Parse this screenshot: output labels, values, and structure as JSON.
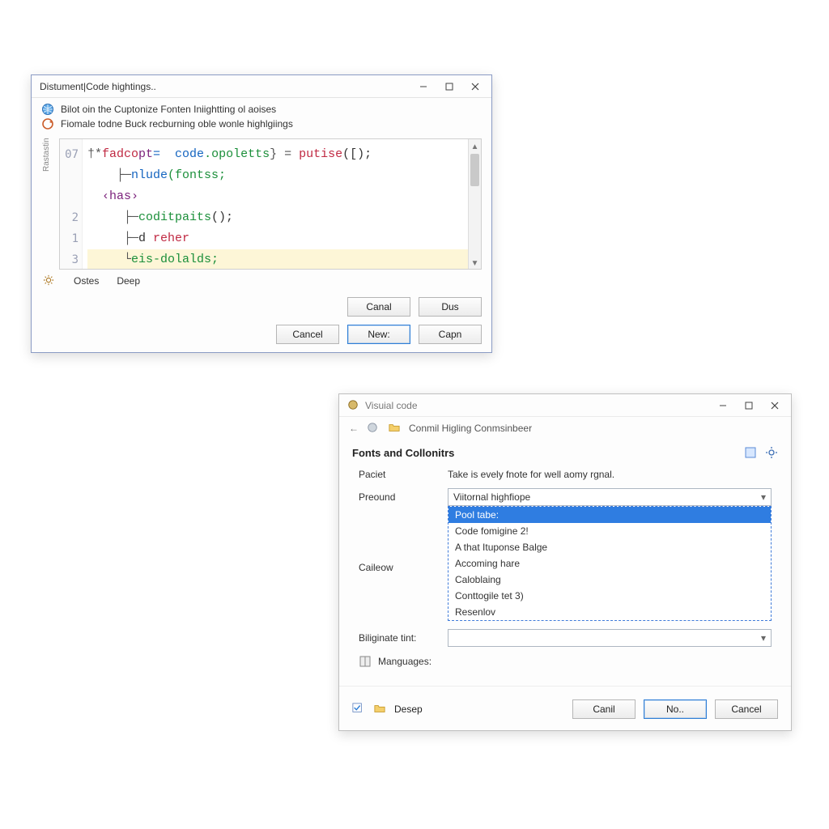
{
  "dialog1": {
    "title": "Distument|Code hightings..",
    "hint1": "Bilot oin the Cuptonize Fonten Iniightting ol aoises",
    "hint2": "Fiomale todne Buck recburning oble wonle highlgiings",
    "rotated_label": "Rastastin",
    "gutter": [
      "07",
      "",
      "",
      "2",
      "1",
      "3"
    ],
    "code_tokens": {
      "l1a": "fadco",
      "l1b": "pt",
      "l1c": "=  code",
      "l1d": ".opoletts",
      "l1e": "} =",
      "l1f": " putise",
      "l1g": "([);",
      "l2a": "nlude",
      "l2b": "(fontss;",
      "l3a": "‹has›",
      "l4a": "coditpaits",
      "l4b": "();",
      "l5a": "d ",
      "l5b": "reher",
      "l6a": "eis-dolalds;"
    },
    "below": {
      "left": "Ostes",
      "right": "Deep"
    },
    "buttons_row1": {
      "a": "Canal",
      "b": "Dus"
    },
    "buttons_row2": {
      "a": "Cancel",
      "b": "New:",
      "c": "Capn"
    }
  },
  "dialog2": {
    "title": "Visuial code",
    "breadcrumb": "Conmil Higling Conmsinbeer",
    "section": "Fonts and Collonitrs",
    "labels": {
      "paciet": "Paciet",
      "paciet_text": "Take is evely fnote for well aomy rgnal.",
      "preound": "Preound",
      "caieow": "Caileow",
      "biliginate": "Biliginate tint:",
      "manguages": "Manguages:"
    },
    "preound_value": "Viitornal highfiope",
    "dropdown": {
      "selected_index": 0,
      "options": [
        "Pool tabe:",
        "Code fomigine 2!",
        "A that Ituponse Balge",
        "Accoming hare",
        "Caloblaing",
        "Conttogile tet 3)",
        "Resenlov"
      ]
    },
    "footer": {
      "desep": "Desep",
      "btn_a": "Canil",
      "btn_b": "No..",
      "btn_c": "Cancel"
    }
  }
}
